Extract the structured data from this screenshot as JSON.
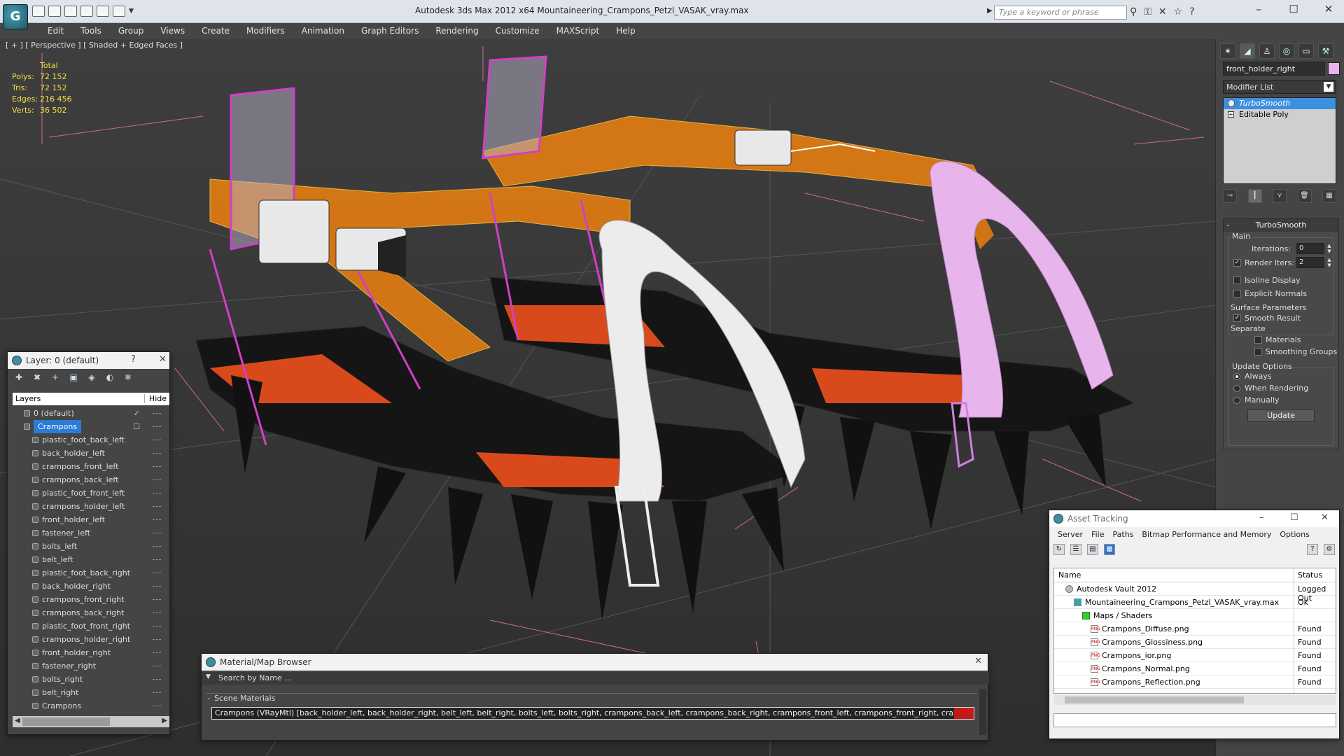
{
  "titlebar": {
    "title": "Autodesk 3ds Max  2012 x64      Mountaineering_Crampons_Petzl_VASAK_vray.max",
    "search_placeholder": "Type a keyword or phrase"
  },
  "menu": [
    "Edit",
    "Tools",
    "Group",
    "Views",
    "Create",
    "Modifiers",
    "Animation",
    "Graph Editors",
    "Rendering",
    "Customize",
    "MAXScript",
    "Help"
  ],
  "viewport": {
    "label": "[ + ] [ Perspective ] [ Shaded + Edged Faces ]",
    "stats": {
      "header": "Total",
      "rows": [
        {
          "key": "Polys:",
          "value": "72 152"
        },
        {
          "key": "Tris:",
          "value": "72 152"
        },
        {
          "key": "Edges:",
          "value": "216 456"
        },
        {
          "key": "Verts:",
          "value": "36 502"
        }
      ]
    }
  },
  "command_panel": {
    "object_name": "front_holder_right",
    "modifier_list_label": "Modifier List",
    "stack": [
      "TurboSmooth",
      "Editable Poly"
    ],
    "turbosmooth": {
      "title": "TurboSmooth",
      "main_label": "Main",
      "iterations_label": "Iterations:",
      "iterations_value": "0",
      "render_iters_label": "Render Iters:",
      "render_iters_value": "2",
      "isoline_label": "Isoline Display",
      "explicit_normals_label": "Explicit Normals",
      "surface_params_label": "Surface Parameters",
      "smooth_result_label": "Smooth Result",
      "separate_label": "Separate",
      "materials_label": "Materials",
      "smoothing_groups_label": "Smoothing Groups",
      "update_options_label": "Update Options",
      "always_label": "Always",
      "when_rendering_label": "When Rendering",
      "manually_label": "Manually",
      "update_button": "Update"
    }
  },
  "layer_window": {
    "title": "Layer: 0 (default)",
    "help": "?",
    "col_layers": "Layers",
    "col_hide": "Hide",
    "rows": [
      {
        "name": "0 (default)",
        "indent": 1
      },
      {
        "name": "Crampons",
        "indent": 1
      },
      {
        "name": "plastic_foot_back_left",
        "indent": 2
      },
      {
        "name": "back_holder_left",
        "indent": 2
      },
      {
        "name": "crampons_front_left",
        "indent": 2
      },
      {
        "name": "crampons_back_left",
        "indent": 2
      },
      {
        "name": "plastic_foot_front_left",
        "indent": 2
      },
      {
        "name": "crampons_holder_left",
        "indent": 2
      },
      {
        "name": "front_holder_left",
        "indent": 2
      },
      {
        "name": "fastener_left",
        "indent": 2
      },
      {
        "name": "bolts_left",
        "indent": 2
      },
      {
        "name": "belt_left",
        "indent": 2
      },
      {
        "name": "plastic_foot_back_right",
        "indent": 2
      },
      {
        "name": "back_holder_right",
        "indent": 2
      },
      {
        "name": "crampons_front_right",
        "indent": 2
      },
      {
        "name": "crampons_back_right",
        "indent": 2
      },
      {
        "name": "plastic_foot_front_right",
        "indent": 2
      },
      {
        "name": "crampons_holder_right",
        "indent": 2
      },
      {
        "name": "front_holder_right",
        "indent": 2
      },
      {
        "name": "fastener_right",
        "indent": 2
      },
      {
        "name": "bolts_right",
        "indent": 2
      },
      {
        "name": "belt_right",
        "indent": 2
      },
      {
        "name": "Crampons",
        "indent": 2
      }
    ]
  },
  "material_browser": {
    "title": "Material/Map Browser",
    "search_placeholder": "Search by Name ...",
    "group_label": "Scene Materials",
    "item": "Crampons (VRayMtl) [back_holder_left, back_holder_right, belt_left, belt_right, bolts_left, bolts_right, crampons_back_left, crampons_back_right, crampons_front_left, crampons_front_right, crampons_holder_lef..."
  },
  "asset_tracking": {
    "title": "Asset Tracking",
    "menu": [
      "Server",
      "File",
      "Paths",
      "Bitmap Performance and Memory",
      "Options"
    ],
    "col_name": "Name",
    "col_status": "Status",
    "rows": [
      {
        "name": "Autodesk Vault 2012",
        "status": "Logged Out",
        "indent": 1,
        "icon": "vault"
      },
      {
        "name": "Mountaineering_Crampons_Petzl_VASAK_vray.max",
        "status": "Ok",
        "indent": 2,
        "icon": "max"
      },
      {
        "name": "Maps / Shaders",
        "status": "",
        "indent": 3,
        "icon": "folder"
      },
      {
        "name": "Crampons_Diffuse.png",
        "status": "Found",
        "indent": 4,
        "icon": "png"
      },
      {
        "name": "Crampons_Glossiness.png",
        "status": "Found",
        "indent": 4,
        "icon": "png"
      },
      {
        "name": "Crampons_ior.png",
        "status": "Found",
        "indent": 4,
        "icon": "png"
      },
      {
        "name": "Crampons_Normal.png",
        "status": "Found",
        "indent": 4,
        "icon": "png"
      },
      {
        "name": "Crampons_Reflection.png",
        "status": "Found",
        "indent": 4,
        "icon": "png"
      }
    ]
  },
  "colors": {
    "stats_text": "#f0e040",
    "selection": "#2b7bd7",
    "belt_orange": "#e07b12",
    "holder_magenta": "#d040c8",
    "holder_pink": "#e7b5ec"
  }
}
